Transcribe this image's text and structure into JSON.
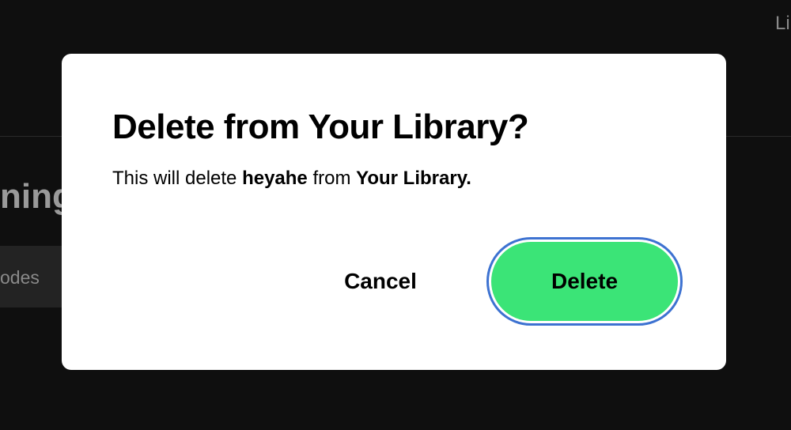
{
  "background": {
    "nav_text": "Li",
    "heading_fragment": "ning",
    "chip_label": "odes"
  },
  "dialog": {
    "title": "Delete from Your Library?",
    "message_prefix": "This will delete ",
    "item_name": "heyahe",
    "message_middle": " from ",
    "library_name": "Your Library.",
    "cancel_label": "Cancel",
    "delete_label": "Delete"
  },
  "colors": {
    "delete_button": "#3be477",
    "focus_ring": "#3d72d1",
    "page_background": "#0f0f0f",
    "dialog_background": "#ffffff"
  }
}
